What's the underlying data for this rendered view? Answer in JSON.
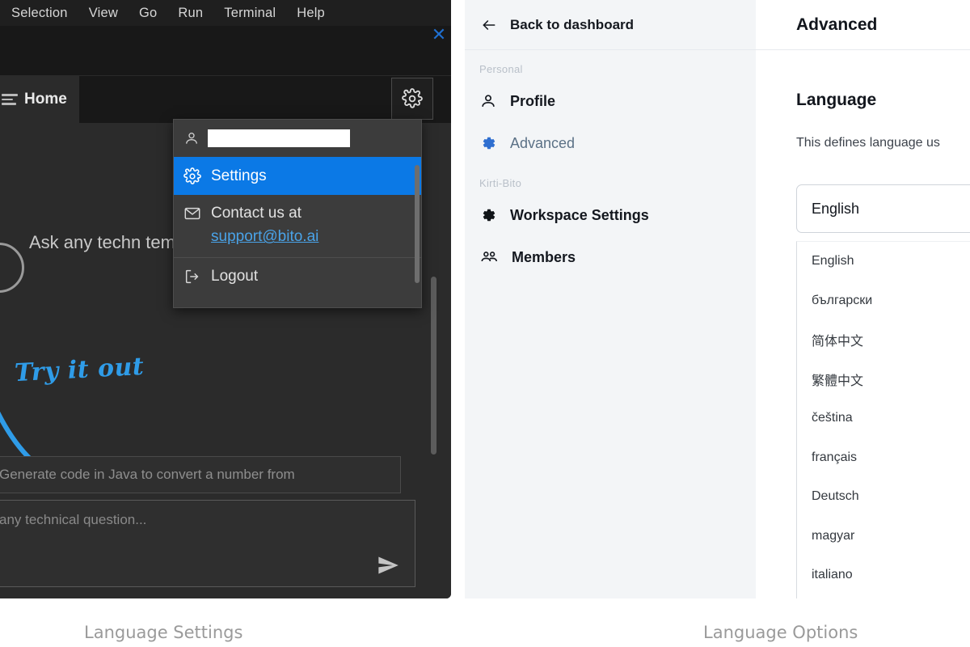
{
  "ide": {
    "menubar": [
      "Selection",
      "View",
      "Go",
      "Run",
      "Terminal",
      "Help"
    ],
    "close_glyph": "✕",
    "tab_label": "Home",
    "gear_icon": "gear-icon",
    "promo_text": "Ask any techn                     templates for IDE",
    "try_it_out": "Try it out",
    "suggestion_text": "Generate code in Java to convert a number from",
    "ask_placeholder": "any technical question...",
    "send_icon": "send-icon"
  },
  "account_menu": {
    "username_value": "",
    "user_icon": "person-icon",
    "settings_label": "Settings",
    "settings_icon": "gear-icon",
    "contact_label": "Contact us at",
    "contact_icon": "mail-icon",
    "contact_email": "support@bito.ai",
    "logout_label": "Logout",
    "logout_icon": "logout-icon",
    "highlight_color": "#0b79e6"
  },
  "settings_sidebar": {
    "back_label": "Back to dashboard",
    "back_icon": "arrow-left-icon",
    "groups": [
      {
        "label": "Personal",
        "items": [
          {
            "label": "Profile",
            "icon": "person-icon",
            "active": false
          },
          {
            "label": "Advanced",
            "icon": "gear-icon",
            "active": true
          }
        ]
      },
      {
        "label": "Kirti-Bito",
        "items": [
          {
            "label": "Workspace Settings",
            "icon": "gear-icon",
            "active": false
          },
          {
            "label": "Members",
            "icon": "group-icon",
            "active": false
          }
        ]
      }
    ],
    "active_color": "#2f6fd0"
  },
  "advanced_pane": {
    "header_title": "Advanced",
    "section_title": "Language",
    "description": "This defines language us",
    "select_value": "English",
    "language_options": [
      "English",
      "български",
      "简体中文",
      "繁體中文",
      "čeština",
      "français",
      "Deutsch",
      "magyar",
      "italiano"
    ]
  },
  "captions": {
    "left": "Language Settings",
    "right": "Language Options"
  }
}
